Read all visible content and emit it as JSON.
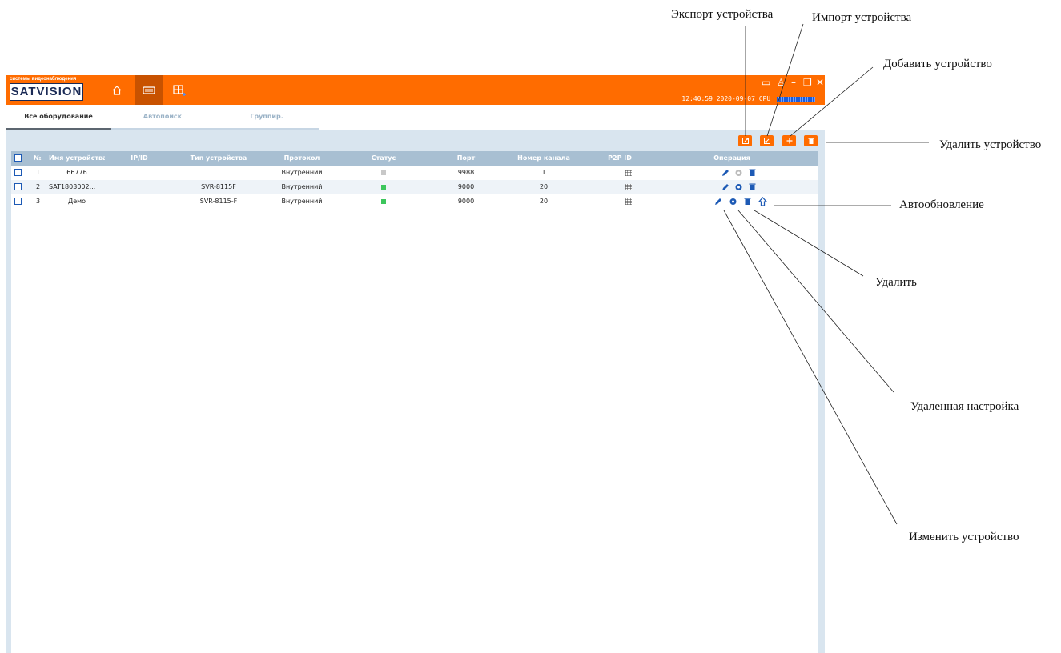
{
  "annotations": {
    "export": "Экспорт устройства",
    "import": "Импорт устройства",
    "add": "Добавить устройство",
    "delete_device": "Удалить устройство",
    "autoupdate": "Автообновление",
    "delete": "Удалить",
    "remote_config": "Удаленная настройка",
    "edit": "Изменить устройство"
  },
  "app": {
    "logo_small": "системы видеонаблюдения",
    "logo_big": "SATVISION",
    "datetime": "12:40:59 2020-09-07",
    "cpu_label": "CPU",
    "colors": {
      "accent": "#ff6c00",
      "header": "#a8bfd2",
      "online": "#3cc65c",
      "offline": "#c8c8c8",
      "icon": "#1d5ab5"
    }
  },
  "tabs": [
    "Все оборудование",
    "Автопоиск",
    "Группир."
  ],
  "toolbar": {
    "export_icon": "export-icon",
    "import_icon": "import-icon",
    "add_icon": "plus-icon",
    "delete_icon": "trash-icon"
  },
  "table": {
    "columns": [
      "№",
      "Имя устройства",
      "IP/ID",
      "Тип устройства",
      "Протокол",
      "Статус",
      "Порт",
      "Номер канала",
      "P2P ID",
      "Операция"
    ],
    "rows": [
      {
        "no": "1",
        "name": "66776",
        "ip": "",
        "type": "",
        "protocol": "Внутренний",
        "status": "offline",
        "port": "9988",
        "channels": "1"
      },
      {
        "no": "2",
        "name": "SAT1803002...",
        "ip": "",
        "type": "SVR-8115F",
        "protocol": "Внутренний",
        "status": "online",
        "port": "9000",
        "channels": "20"
      },
      {
        "no": "3",
        "name": "Демо",
        "ip": "",
        "type": "SVR-8115-F",
        "protocol": "Внутренний",
        "status": "online",
        "port": "9000",
        "channels": "20"
      }
    ]
  }
}
